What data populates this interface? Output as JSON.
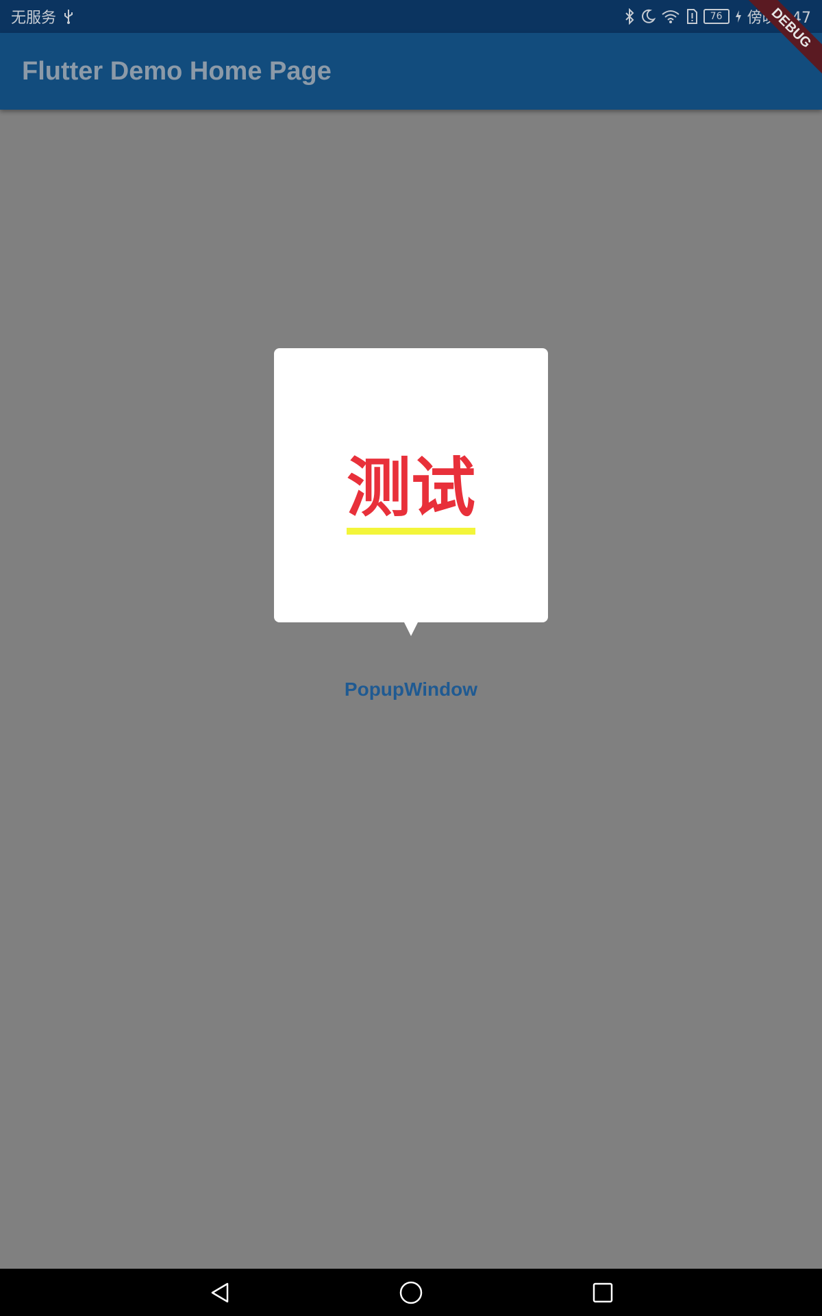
{
  "status_bar": {
    "carrier": "无服务",
    "battery": "76",
    "time": "傍晚5:47",
    "icons": [
      "usb-icon",
      "bluetooth-icon",
      "moon-icon",
      "wifi-icon",
      "sim-alert-icon",
      "battery-icon",
      "charging-icon"
    ]
  },
  "app_bar": {
    "title": "Flutter Demo Home Page"
  },
  "debug_banner": "DEBUG",
  "popup": {
    "content_text": "测试",
    "text_color": "#e8303a",
    "underline_color": "#f3f53a"
  },
  "main": {
    "button_label": "PopupWindow"
  },
  "nav_bar": {
    "icons": [
      "back-icon",
      "home-icon",
      "recents-icon"
    ]
  },
  "colors": {
    "status_bar_bg": "#0b3460",
    "app_bar_bg": "#124c7d",
    "scrim_bg": "#808080",
    "button_text": "#1f5a92"
  }
}
